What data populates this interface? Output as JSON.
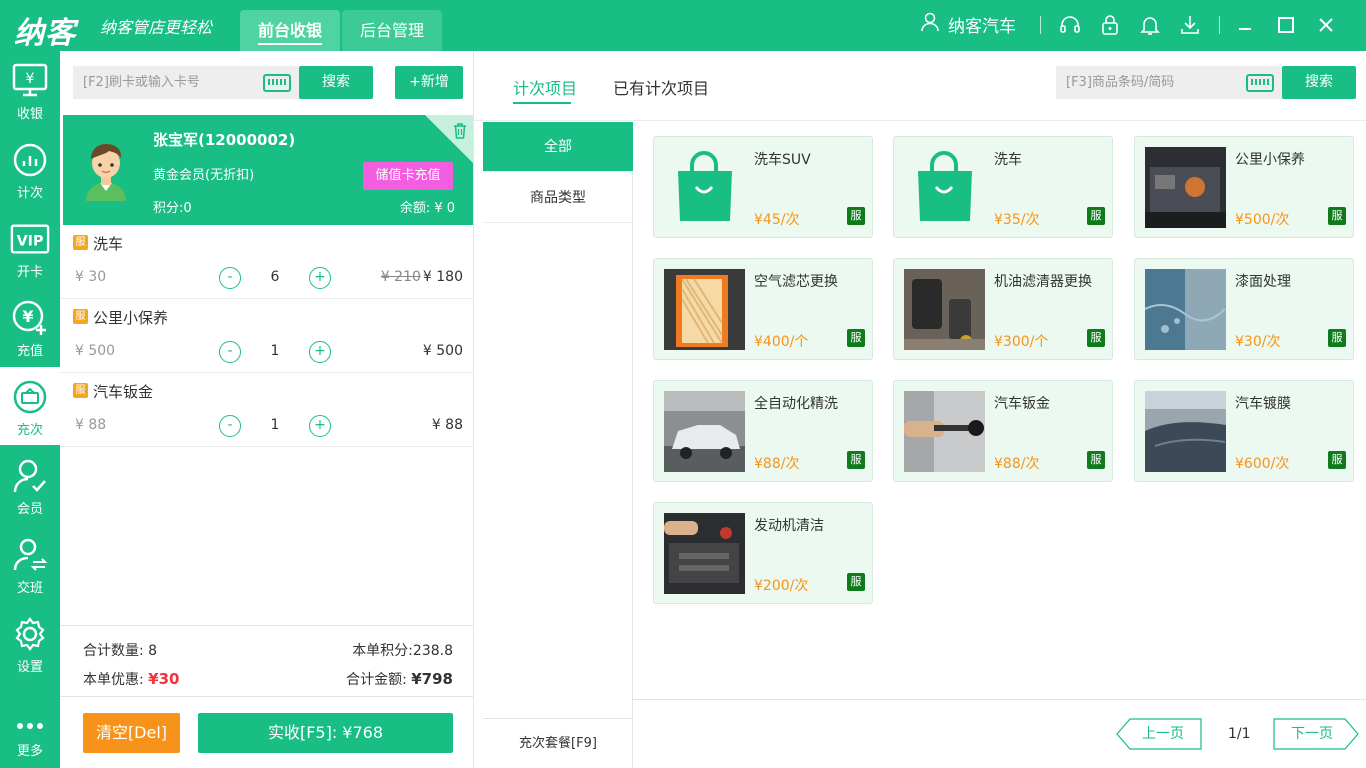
{
  "brand": {
    "logo": "纳客",
    "slogan": "纳客管店更轻松"
  },
  "top_tabs": [
    "前台收银",
    "后台管理"
  ],
  "user": {
    "name": "纳客汽车"
  },
  "nav": [
    {
      "label": "收银",
      "icon": "monitor-yen-icon"
    },
    {
      "label": "计次",
      "icon": "bar-chart-icon"
    },
    {
      "label": "开卡",
      "icon": "vip-card-icon"
    },
    {
      "label": "充值",
      "icon": "yen-plus-icon"
    },
    {
      "label": "充次",
      "icon": "recharge-times-icon"
    },
    {
      "label": "会员",
      "icon": "member-icon"
    },
    {
      "label": "交班",
      "icon": "shift-icon"
    },
    {
      "label": "设置",
      "icon": "gear-icon"
    },
    {
      "label": "更多",
      "icon": "more-icon"
    }
  ],
  "cart": {
    "card_placeholder": "[F2]刷卡或输入卡号",
    "search_label": "搜索",
    "add_label": "+新增",
    "member": {
      "name": "张宝军(12000002)",
      "level": "黄金会员(无折扣)",
      "recharge_label": "储值卡充值",
      "points": "积分:0",
      "balance": "余额: ¥ 0"
    },
    "items": [
      {
        "badge": "服",
        "name": "洗车",
        "price": "¥ 30",
        "minus": "-",
        "qty": "6",
        "plus": "+",
        "orig_total": "¥ 210",
        "total": "¥ 180"
      },
      {
        "badge": "服",
        "name": "公里小保养",
        "price": "¥ 500",
        "minus": "-",
        "qty": "1",
        "plus": "+",
        "orig_total": "",
        "total": "¥ 500"
      },
      {
        "badge": "服",
        "name": "汽车钣金",
        "price": "¥ 88",
        "minus": "-",
        "qty": "1",
        "plus": "+",
        "orig_total": "",
        "total": "¥ 88"
      }
    ],
    "summary": {
      "count_label": "合计数量:",
      "count": "8",
      "points_label": "本单积分:",
      "points": "238.8",
      "discount_label": "本单优惠:",
      "discount": "¥30",
      "total_label": "合计金额:",
      "total": "¥798"
    },
    "clear_label": "清空[Del]",
    "pay_label": "实收[F5]: ¥768"
  },
  "main": {
    "tabs": [
      "计次项目",
      "已有计次项目"
    ],
    "barcode_placeholder": "[F3]商品条码/简码",
    "search_label": "搜索",
    "categories": [
      "全部",
      "商品类型"
    ],
    "package_label": "充次套餐[F9]",
    "products": [
      {
        "name": "洗车SUV",
        "price": "¥45/次",
        "tag": "服",
        "thumb": "shopping-bag-icon"
      },
      {
        "name": "洗车",
        "price": "¥35/次",
        "tag": "服",
        "thumb": "shopping-bag-icon"
      },
      {
        "name": "公里小保养",
        "price": "¥500/次",
        "tag": "服",
        "thumb": "engine-photo"
      },
      {
        "name": "空气滤芯更换",
        "price": "¥400/个",
        "tag": "服",
        "thumb": "air-filter-photo"
      },
      {
        "name": "机油滤清器更换",
        "price": "¥300/个",
        "tag": "服",
        "thumb": "oil-filter-photo"
      },
      {
        "name": "漆面处理",
        "price": "¥30/次",
        "tag": "服",
        "thumb": "paint-photo"
      },
      {
        "name": "全自动化精洗",
        "price": "¥88/次",
        "tag": "服",
        "thumb": "white-car-photo"
      },
      {
        "name": "汽车钣金",
        "price": "¥88/次",
        "tag": "服",
        "thumb": "dent-repair-photo"
      },
      {
        "name": "汽车镀膜",
        "price": "¥600/次",
        "tag": "服",
        "thumb": "dark-car-photo"
      },
      {
        "name": "发动机清洁",
        "price": "¥200/次",
        "tag": "服",
        "thumb": "engine-clean-photo"
      }
    ],
    "pager": {
      "prev": "上一页",
      "page": "1/1",
      "next": "下一页"
    }
  },
  "colors": {
    "primary": "#18be84",
    "orange": "#f7931a",
    "pink": "#f35ee1",
    "red": "#f2323c",
    "tag": "#0f7b1d"
  }
}
